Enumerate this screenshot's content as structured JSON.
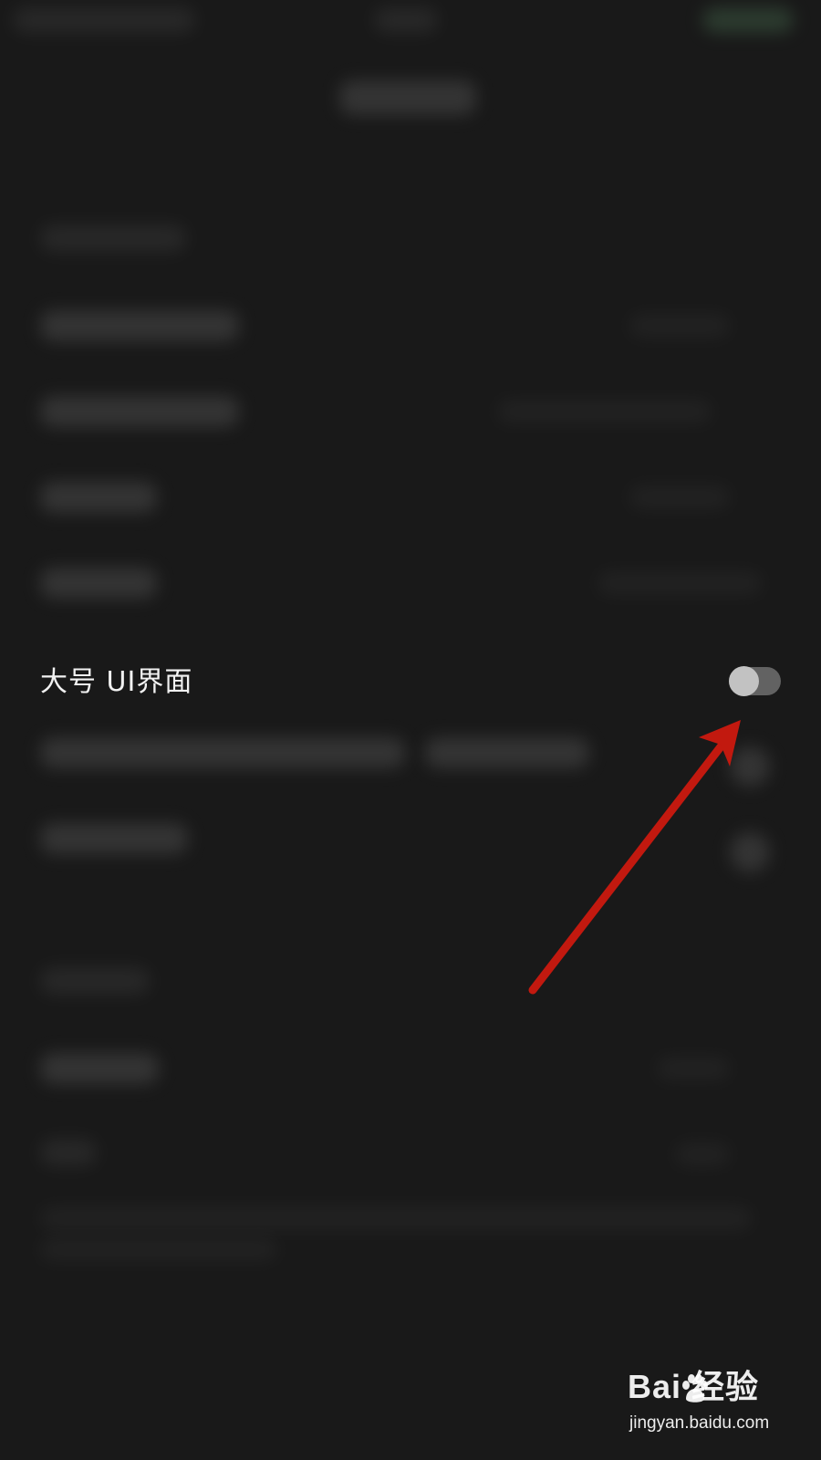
{
  "settings": {
    "large_ui": {
      "label": "大号 UI界面",
      "enabled": false
    }
  },
  "annotation": {
    "arrow_color": "#c2190f"
  },
  "watermark": {
    "logo": "Bai  经验",
    "url": "jingyan.baidu.com"
  },
  "colors": {
    "background": "#191919",
    "toggle_track": "#626262",
    "toggle_knob": "#c2c2c2"
  }
}
